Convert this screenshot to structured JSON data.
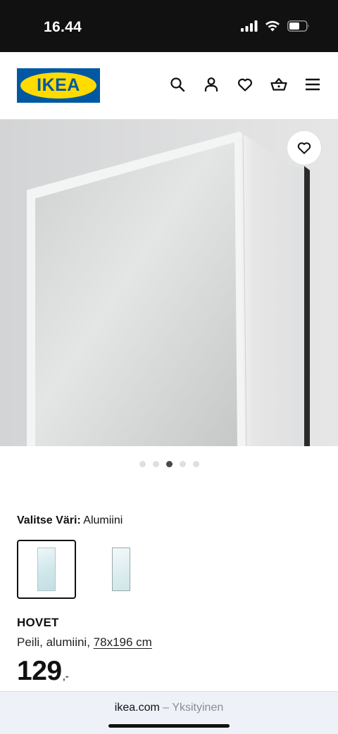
{
  "status_bar": {
    "time": "16.44",
    "icons": [
      "signal-icon",
      "wifi-icon",
      "battery-icon"
    ]
  },
  "header": {
    "logo_text": "IKEA",
    "icons": [
      "search-icon",
      "user-icon",
      "heart-icon",
      "basket-icon",
      "menu-icon"
    ],
    "colors": {
      "logo_blue": "#0058a3",
      "logo_yellow": "#ffdb00"
    }
  },
  "gallery": {
    "image_count": 5,
    "active_index": 2,
    "favourite_icon": "heart-icon"
  },
  "color_select": {
    "label": "Valitse Väri:",
    "value": "Alumiini",
    "options": [
      {
        "name": "mirror-aluminium",
        "selected": true
      },
      {
        "name": "mirror-alternative",
        "selected": false
      }
    ]
  },
  "product": {
    "name": "HOVET",
    "description": "Peili, alumiini,",
    "dimensions": "78x196 cm",
    "price": "129",
    "price_suffix": ",-"
  },
  "browser": {
    "domain": "ikea.com",
    "separator": "–",
    "mode": "Yksityinen"
  }
}
